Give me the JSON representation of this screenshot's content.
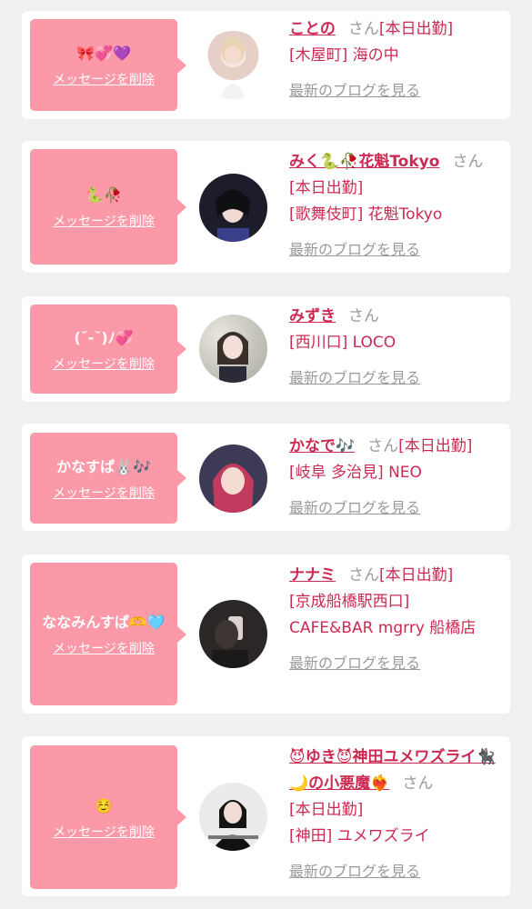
{
  "common": {
    "delete_label": "メッセージを削除",
    "san_label": "さん",
    "blog_label": "最新のブログを見る"
  },
  "cards": [
    {
      "message": "🎀💞💜",
      "name": "ことの",
      "line1": "[本日出勤]",
      "line2": "[木屋町] 海の中"
    },
    {
      "message": "🐍🥀",
      "name": "みく🐍🥀花魁Tokyo",
      "line1": "[本日出勤]",
      "line2": "[歌舞伎町] 花魁Tokyo"
    },
    {
      "message": "(˘-˘)ﾉ💞",
      "name": "みずき",
      "line1": "",
      "line2": "[西川口] LOCO"
    },
    {
      "message": "かなすぱ🐰🎶",
      "name": "かなで🎶",
      "line1": "[本日出勤]",
      "line2": "[岐阜 多治見] NEO"
    },
    {
      "message": "ななみんすぱ🫶🩵",
      "name": "ナナミ",
      "line1": "[本日出勤]",
      "line2": "[京成船橋駅西口] CAFE&BAR mgrry 船橋店"
    },
    {
      "message": "☺️",
      "name": "😈ゆき😈神田ユメワズライ🐈‍⬛🌙の小悪魔❤️‍🔥",
      "line1": "[本日出勤]",
      "line2": "[神田] ユメワズライ"
    }
  ]
}
